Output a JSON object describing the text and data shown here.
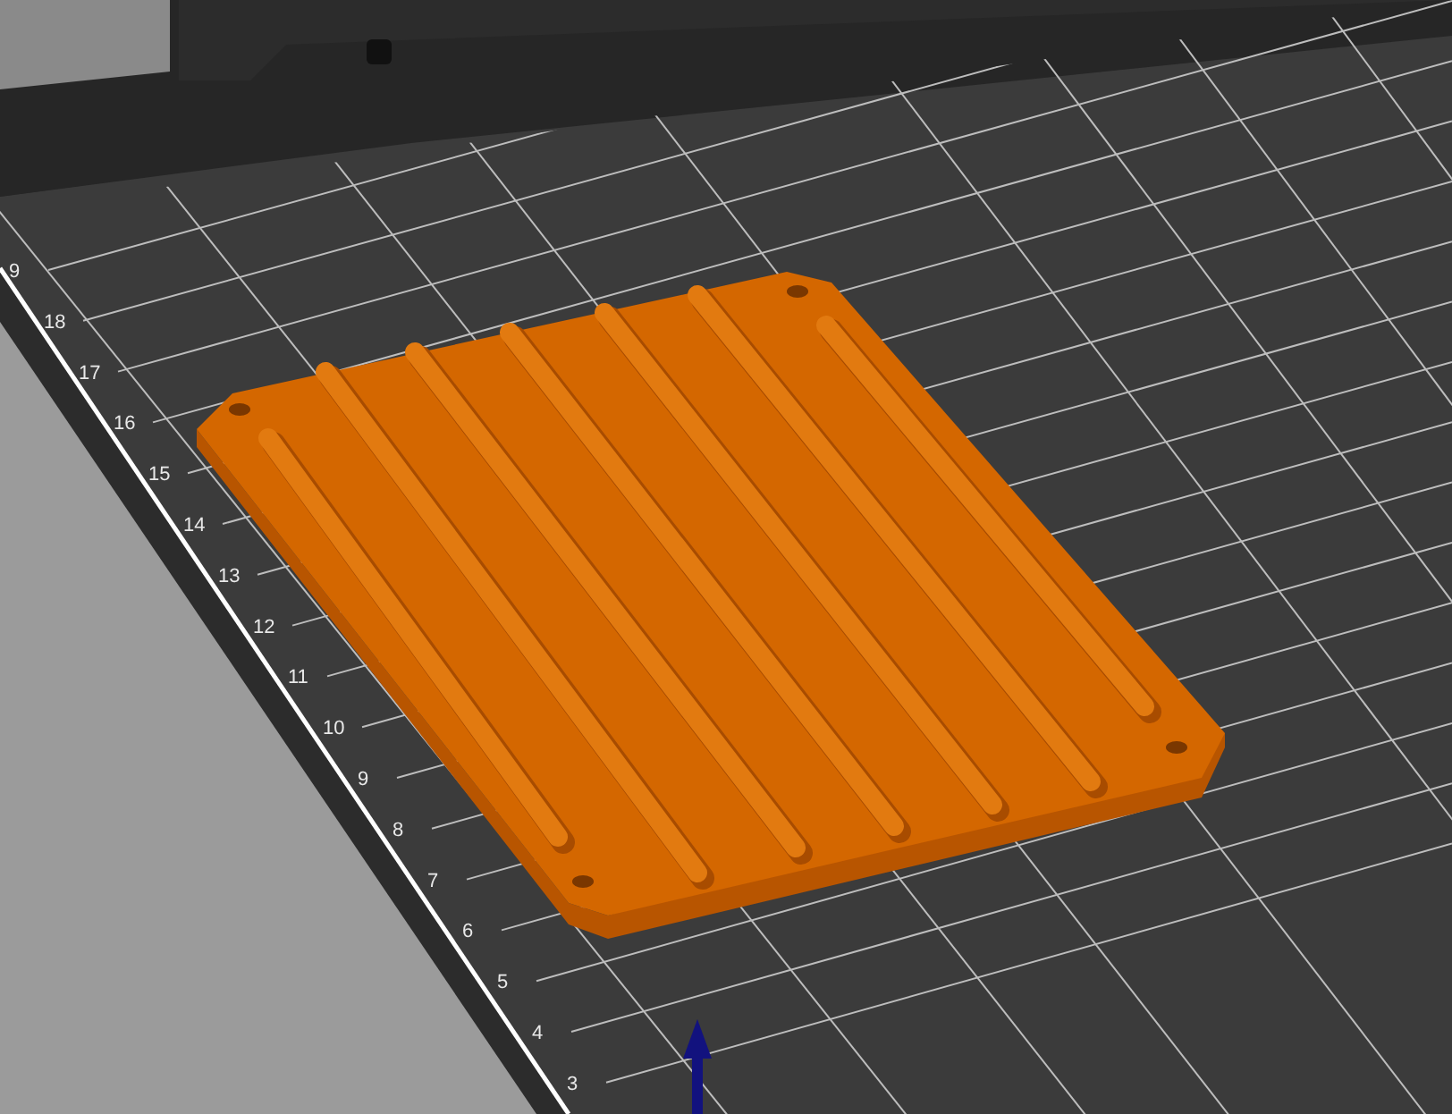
{
  "bed": {
    "axis_labels": [
      "9",
      "18",
      "17",
      "16",
      "15",
      "14",
      "13",
      "12",
      "11",
      "10",
      "9",
      "8",
      "7",
      "6",
      "5",
      "4",
      "3"
    ]
  }
}
